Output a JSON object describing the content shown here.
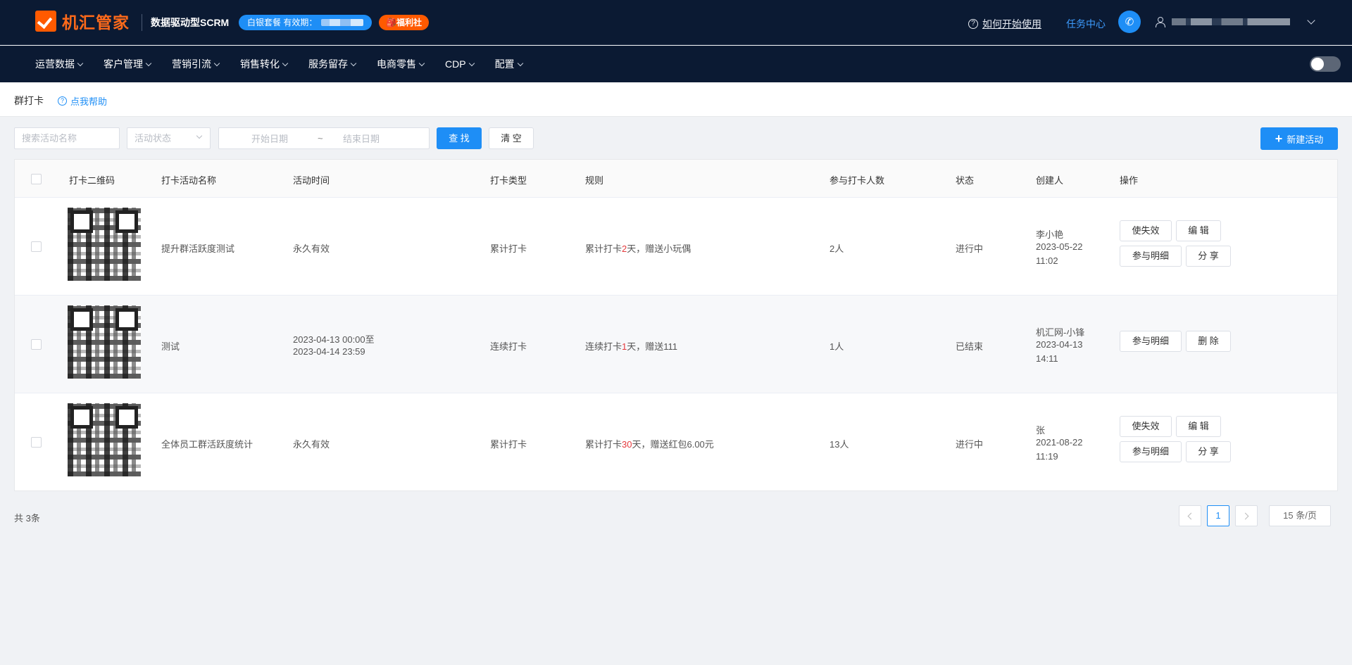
{
  "header": {
    "logo_text": "机汇管家",
    "subtitle": "数据驱动型SCRM",
    "package_badge": "白银套餐 有效期：",
    "welfare_badge": "🎒福利社",
    "help_start": "如何开始使用",
    "task_center": "任务中心"
  },
  "nav": {
    "items": [
      "运营数据",
      "客户管理",
      "营销引流",
      "销售转化",
      "服务留存",
      "电商零售",
      "CDP",
      "配置"
    ]
  },
  "breadcrumb": {
    "title": "群打卡",
    "help": "点我帮助"
  },
  "filters": {
    "search_placeholder": "搜索活动名称",
    "status_placeholder": "活动状态",
    "start_date_placeholder": "开始日期",
    "range_separator": "~",
    "end_date_placeholder": "结束日期",
    "search_button": "查 找",
    "clear_button": "清 空",
    "new_button": "新建活动"
  },
  "table": {
    "columns": [
      "打卡二维码",
      "打卡活动名称",
      "活动时间",
      "打卡类型",
      "规则",
      "参与打卡人数",
      "状态",
      "创建人",
      "操作"
    ],
    "rows": [
      {
        "name": "提升群活跃度测试",
        "time_line1": "永久有效",
        "time_line2": "",
        "type": "累计打卡",
        "rule_pre": "累计打卡",
        "rule_num": "2",
        "rule_post": "天，赠送小玩偶",
        "count": "2人",
        "status": "进行中",
        "creator": "李小艳",
        "created_date": "2023-05-22",
        "created_time": "11:02",
        "actions": [
          "使失效",
          "编 辑",
          "参与明细",
          "分 享"
        ]
      },
      {
        "name": "测试",
        "time_line1": "2023-04-13 00:00至",
        "time_line2": "2023-04-14 23:59",
        "type": "连续打卡",
        "rule_pre": "连续打卡",
        "rule_num": "1",
        "rule_post": "天，赠送111",
        "count": "1人",
        "status": "已结束",
        "creator": "机汇网-小锋",
        "created_date": "2023-04-13",
        "created_time": "14:11",
        "actions": [
          "参与明细",
          "删 除"
        ]
      },
      {
        "name": "全体员工群活跃度统计",
        "time_line1": "永久有效",
        "time_line2": "",
        "type": "累计打卡",
        "rule_pre": "累计打卡",
        "rule_num": "30",
        "rule_post": "天，赠送红包6.00元",
        "count": "13人",
        "status": "进行中",
        "creator": "张",
        "created_date": "2021-08-22",
        "created_time": "11:19",
        "actions": [
          "使失效",
          "编 辑",
          "参与明细",
          "分 享"
        ]
      }
    ]
  },
  "footer": {
    "total": "共 3条",
    "current_page": "1",
    "page_size": "15 条/页"
  },
  "colors": {
    "header_bg": "#0b1a33",
    "primary": "#1e8ef6",
    "brand_orange": "#ff5a00",
    "rule_highlight": "#e4393c"
  }
}
